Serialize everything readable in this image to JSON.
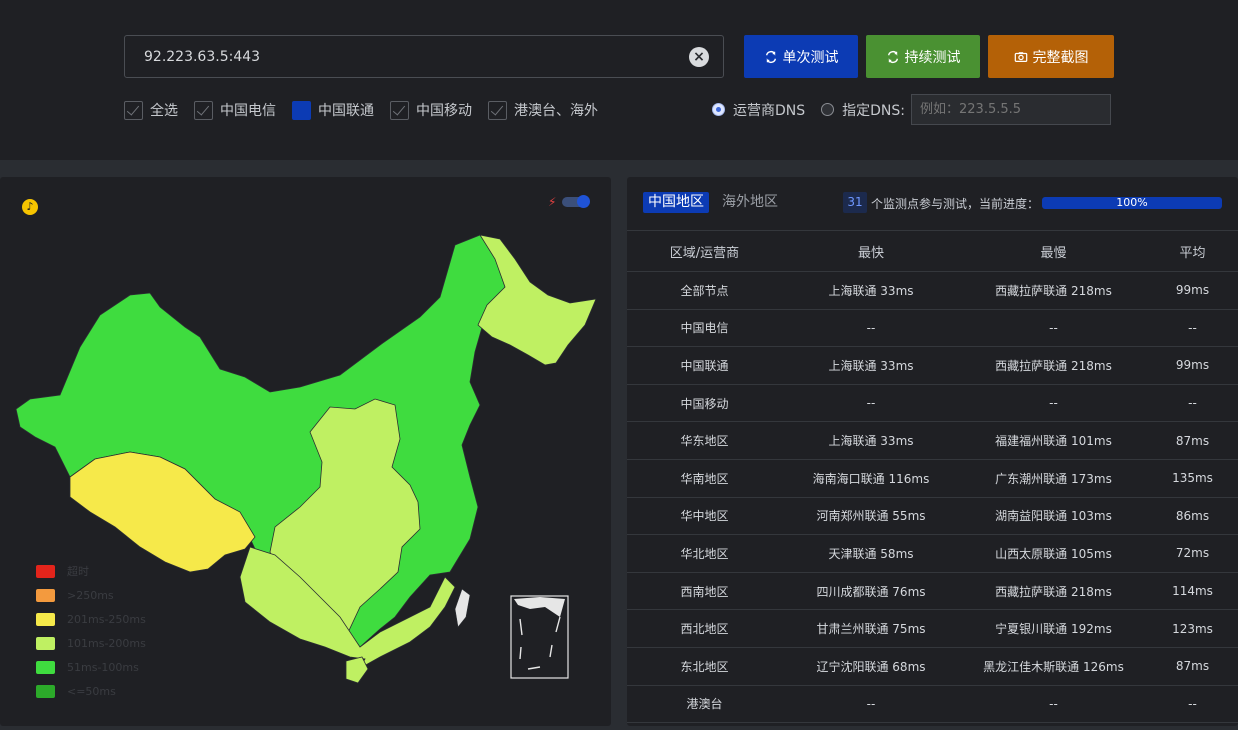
{
  "toolbar": {
    "url_value": "92.223.63.5:443",
    "clear_glyph": "×",
    "single_test_label": "单次测试",
    "continuous_test_label": "持续测试",
    "screenshot_label": "完整截图"
  },
  "filters": [
    {
      "label": "全选",
      "state": "checked"
    },
    {
      "label": "中国电信",
      "state": "checked"
    },
    {
      "label": "中国联通",
      "state": "filled"
    },
    {
      "label": "中国移动",
      "state": "checked"
    },
    {
      "label": "港澳台、海外",
      "state": "checked"
    }
  ],
  "dns": {
    "carrier_label": "运营商DNS",
    "custom_label": "指定DNS:",
    "custom_placeholder": "例如：223.5.5.5",
    "selected": "carrier"
  },
  "map": {
    "legend": [
      {
        "label": "超时",
        "color": "#e3241b"
      },
      {
        "label": ">250ms",
        "color": "#f39a3e"
      },
      {
        "label": "201ms-250ms",
        "color": "#f6e94a"
      },
      {
        "label": "101ms-200ms",
        "color": "#bff062"
      },
      {
        "label": "51ms-100ms",
        "color": "#3fdc3f"
      },
      {
        "label": "<=50ms",
        "color": "#2caa2a"
      }
    ]
  },
  "results": {
    "tabs": [
      "中国地区",
      "海外地区"
    ],
    "node_count": "31",
    "node_count_text": "个监测点参与测试，当前进度：",
    "progress_pct": 100,
    "progress_label": "100%",
    "columns": [
      "区域/运营商",
      "最快",
      "最慢",
      "平均"
    ],
    "rows": [
      [
        "全部节点",
        "上海联通 33ms",
        "西藏拉萨联通 218ms",
        "99ms"
      ],
      [
        "中国电信",
        "--",
        "--",
        "--"
      ],
      [
        "中国联通",
        "上海联通 33ms",
        "西藏拉萨联通 218ms",
        "99ms"
      ],
      [
        "中国移动",
        "--",
        "--",
        "--"
      ],
      [
        "华东地区",
        "上海联通 33ms",
        "福建福州联通 101ms",
        "87ms"
      ],
      [
        "华南地区",
        "海南海口联通 116ms",
        "广东潮州联通 173ms",
        "135ms"
      ],
      [
        "华中地区",
        "河南郑州联通 55ms",
        "湖南益阳联通 103ms",
        "86ms"
      ],
      [
        "华北地区",
        "天津联通 58ms",
        "山西太原联通 105ms",
        "72ms"
      ],
      [
        "西南地区",
        "四川成都联通 76ms",
        "西藏拉萨联通 218ms",
        "114ms"
      ],
      [
        "西北地区",
        "甘肃兰州联通 75ms",
        "宁夏银川联通 192ms",
        "123ms"
      ],
      [
        "东北地区",
        "辽宁沈阳联通 68ms",
        "黑龙江佳木斯联通 126ms",
        "87ms"
      ],
      [
        "港澳台",
        "--",
        "--",
        "--"
      ]
    ]
  }
}
